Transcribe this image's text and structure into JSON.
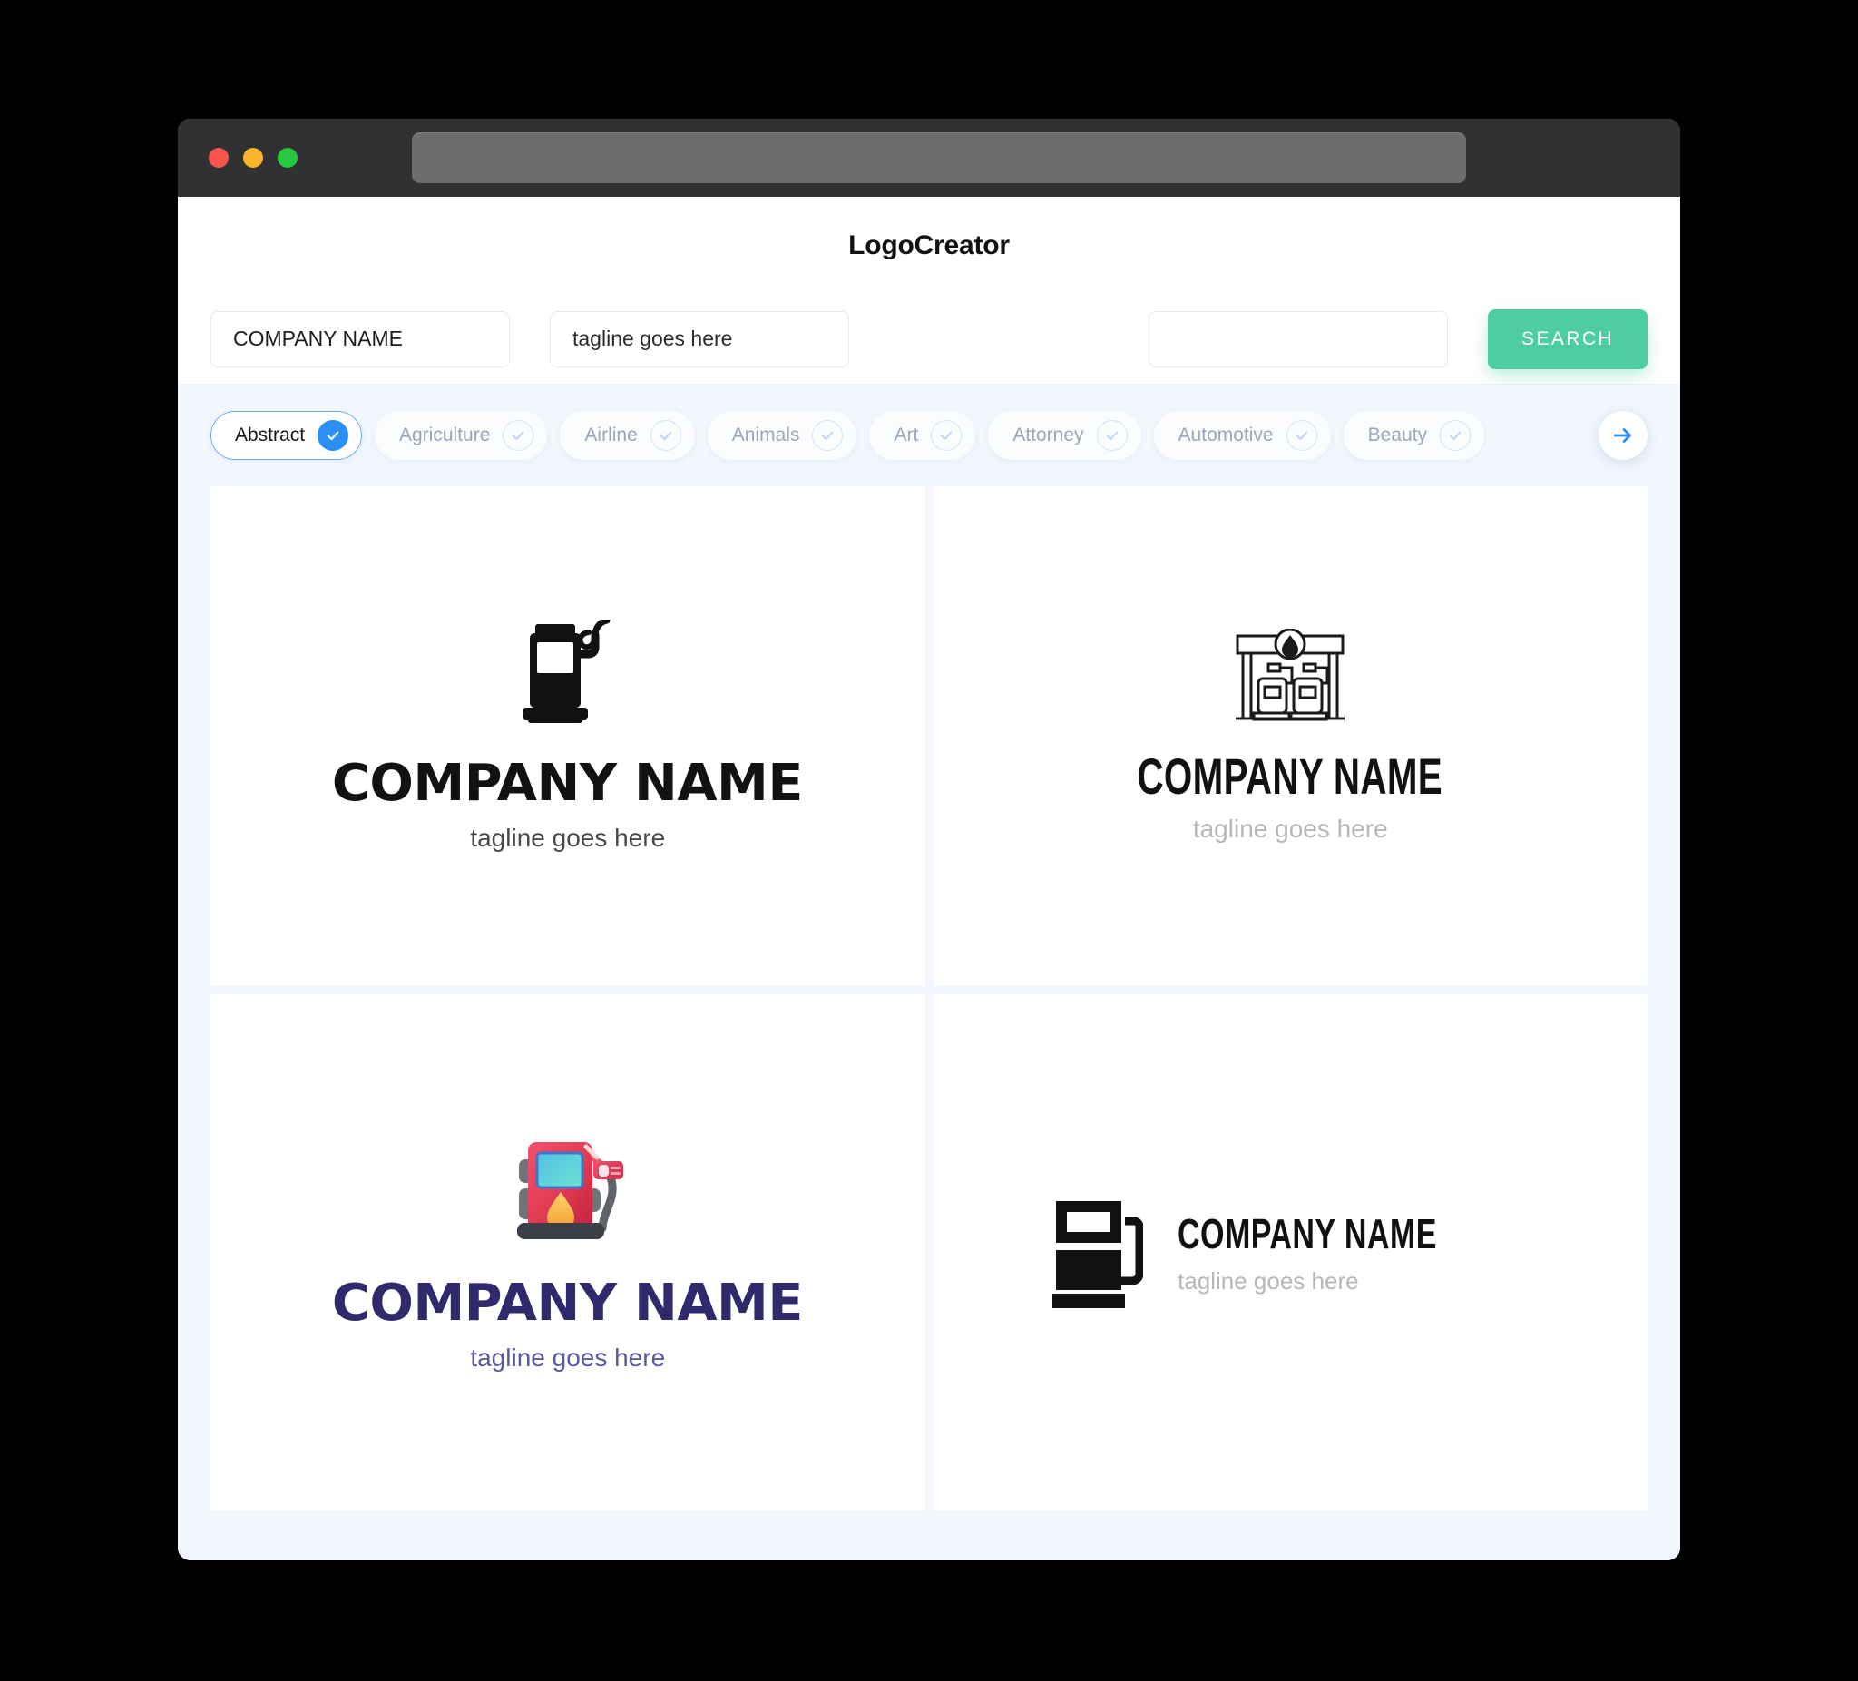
{
  "window": {
    "traffic_lights": [
      {
        "name": "close",
        "color": "#f9544b"
      },
      {
        "name": "minimize",
        "color": "#fab42c"
      },
      {
        "name": "maximize",
        "color": "#26c940"
      }
    ],
    "url_value": ""
  },
  "header": {
    "title": "LogoCreator"
  },
  "search": {
    "company_value": "COMPANY NAME",
    "company_placeholder": "COMPANY NAME",
    "tagline_value": "tagline goes here",
    "tagline_placeholder": "tagline goes here",
    "extra_value": "",
    "extra_placeholder": "",
    "button_label": "SEARCH",
    "button_color": "#4ecca2"
  },
  "categories": {
    "accent_color": "#2b8ff5",
    "next_icon": "arrow-right-icon",
    "items": [
      {
        "label": "Abstract",
        "selected": true
      },
      {
        "label": "Agriculture",
        "selected": false
      },
      {
        "label": "Airline",
        "selected": false
      },
      {
        "label": "Animals",
        "selected": false
      },
      {
        "label": "Art",
        "selected": false
      },
      {
        "label": "Attorney",
        "selected": false
      },
      {
        "label": "Automotive",
        "selected": false
      },
      {
        "label": "Beauty",
        "selected": false
      }
    ]
  },
  "logos": [
    {
      "id": "logo-1",
      "icon": "fuel-pump-silhouette-icon",
      "layout": "stacked",
      "name": "COMPANY NAME",
      "tagline": "tagline goes here",
      "name_color": "#121212",
      "tagline_color": "#4a4a4a"
    },
    {
      "id": "logo-2",
      "icon": "gas-station-outline-icon",
      "layout": "stacked",
      "name": "COMPANY NAME",
      "tagline": "tagline goes here",
      "name_color": "#111111",
      "tagline_color": "#b7b7b7"
    },
    {
      "id": "logo-3",
      "icon": "fuel-pump-color-icon",
      "layout": "stacked",
      "name": "COMPANY NAME",
      "tagline": "tagline goes here",
      "name_color": "#2e2a6b",
      "tagline_color": "#5b59a0"
    },
    {
      "id": "logo-4",
      "icon": "fuel-pump-block-icon",
      "layout": "horizontal",
      "name": "COMPANY NAME",
      "tagline": "tagline goes here",
      "name_color": "#111111",
      "tagline_color": "#b7b7b7"
    }
  ]
}
